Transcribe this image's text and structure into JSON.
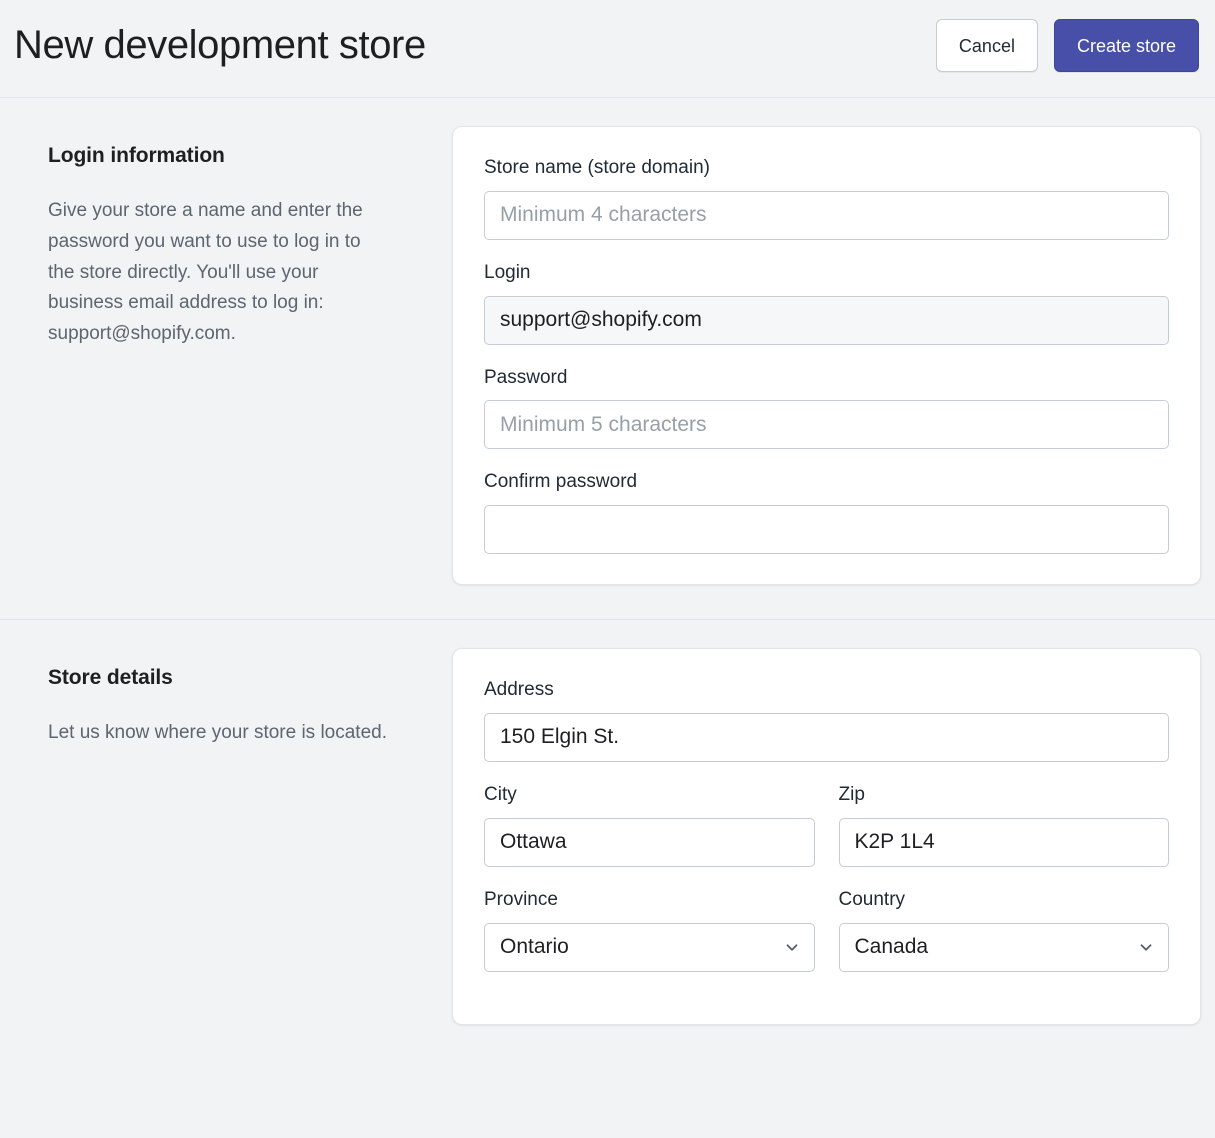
{
  "header": {
    "title": "New development store",
    "cancel_label": "Cancel",
    "create_label": "Create store",
    "primary_color": "#474fa8"
  },
  "sections": [
    {
      "aside_title": "Login information",
      "aside_text": "Give your store a name and enter the password you want to use to log in to the store directly. You'll use your business email address to log in: support@shopify.com.",
      "fields": {
        "store_name": {
          "label": "Store name (store domain)",
          "placeholder": "Minimum 4 characters",
          "value": ""
        },
        "login": {
          "label": "Login",
          "placeholder": "",
          "value": "support@shopify.com"
        },
        "password": {
          "label": "Password",
          "placeholder": "Minimum 5 characters",
          "value": ""
        },
        "confirm_password": {
          "label": "Confirm password",
          "placeholder": "",
          "value": ""
        }
      }
    },
    {
      "aside_title": "Store details",
      "aside_text": "Let us know where your store is located.",
      "fields": {
        "address": {
          "label": "Address",
          "placeholder": "",
          "value": "150 Elgin St."
        },
        "city": {
          "label": "City",
          "placeholder": "",
          "value": "Ottawa"
        },
        "zip": {
          "label": "Zip",
          "placeholder": "",
          "value": "K2P 1L4"
        },
        "province": {
          "label": "Province",
          "value": "Ontario",
          "icon": "chevron-down-icon"
        },
        "country": {
          "label": "Country",
          "value": "Canada",
          "icon": "chevron-down-icon"
        }
      }
    }
  ]
}
